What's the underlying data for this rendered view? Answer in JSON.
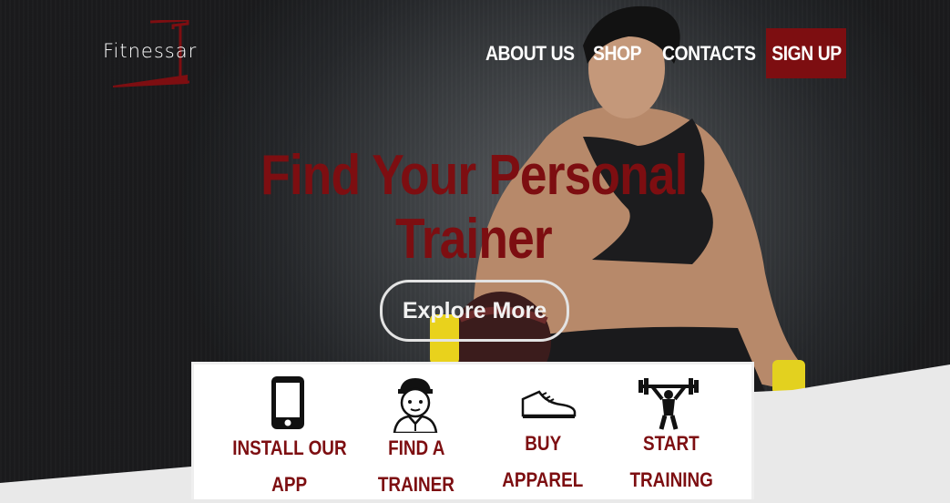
{
  "brand": {
    "logo_text": "Fitnessar"
  },
  "nav": {
    "items": [
      {
        "label": "ABOUT US"
      },
      {
        "label": "SHOP"
      },
      {
        "label": "CONTACTS"
      }
    ],
    "signup_label": "SIGN UP"
  },
  "hero": {
    "headline_line1": "Find Your Personal",
    "headline_line2": "Trainer",
    "cta_label": "Explore More"
  },
  "features": [
    {
      "line1": "INSTALL OUR",
      "line2": "APP",
      "icon": "smartphone-icon"
    },
    {
      "line1": "FIND A",
      "line2": "TRAINER",
      "icon": "trainer-icon"
    },
    {
      "line1": "BUY",
      "line2": "APPAREL",
      "icon": "sneaker-icon"
    },
    {
      "line1": "START",
      "line2": "TRAINING",
      "icon": "weightlifter-icon"
    }
  ],
  "colors": {
    "accent": "#7d0e11",
    "text_light": "#ffffff",
    "panel": "#ffffff"
  }
}
